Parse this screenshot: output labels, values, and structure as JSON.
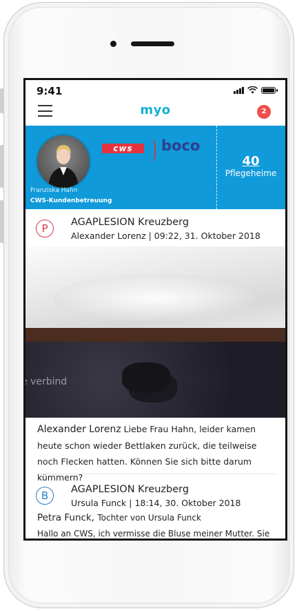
{
  "status_bar": {
    "time": "9:41"
  },
  "header": {
    "app_name": "myo",
    "notification_count": "2"
  },
  "banner": {
    "person_name": "Franziska Hahn",
    "person_role": "CWS-Kundenbetreuung",
    "logo_left": "cws",
    "logo_right": "boco",
    "stat_value": "40",
    "stat_label": "Pflegeheime",
    "background_color": "#109ad9"
  },
  "posts": [
    {
      "badge": "P",
      "title": "AGAPLESION Kreuzberg",
      "meta": "Alexander Lorenz | 09:22, 31. Oktober 2018",
      "photo_overlay_text": "e verbind",
      "comment_author": "Alexander Lorenz",
      "comment_text": "Liebe Frau Hahn, leider kamen heute schon wieder Bettlaken zurück, die teilweise noch Flecken hatten. Können Sie sich bitte darum kümmern?"
    },
    {
      "badge": "B",
      "title": "AGAPLESION Kreuzberg",
      "meta": "Ursula Funck | 18:14, 30. Oktober 2018",
      "comment_author": "Petra Funck,",
      "comment_relation": "Tochter von Ursula Funck",
      "comment_text": "Hallo an CWS, ich vermisse die Bluse meiner Mutter. Sie"
    }
  ],
  "colors": {
    "accent": "#12b2cf",
    "badge_red": "#ef4f4a",
    "p_badge": "#d33a4a",
    "b_badge": "#2a7fc6"
  },
  "icons": [
    "menu-icon",
    "signal-icon",
    "wifi-icon",
    "battery-icon"
  ]
}
